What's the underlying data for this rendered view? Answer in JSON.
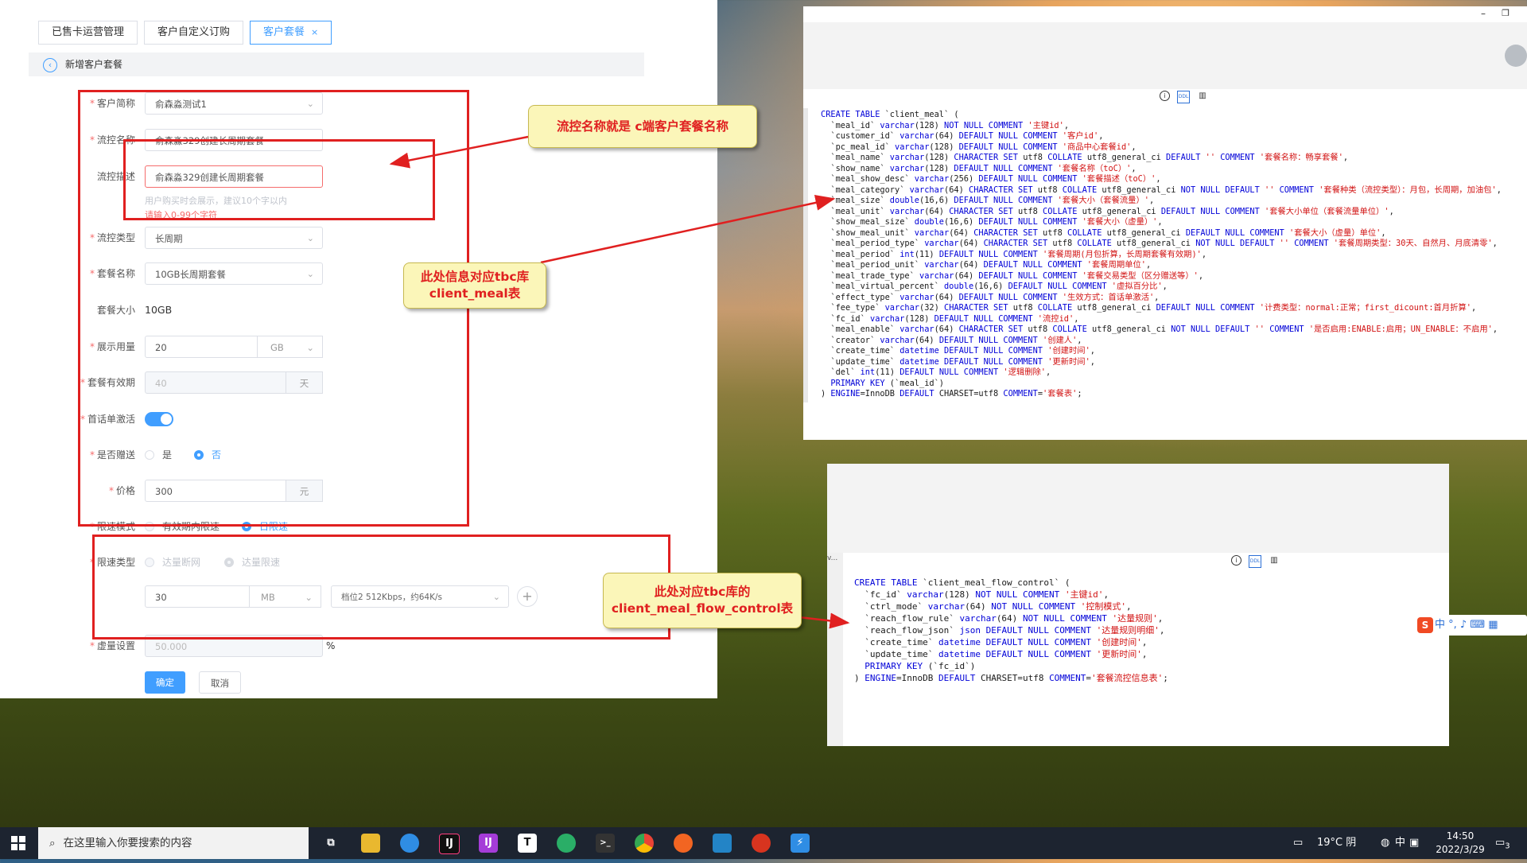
{
  "form": {
    "tabs": [
      {
        "label": "已售卡运营管理"
      },
      {
        "label": "客户自定义订购"
      },
      {
        "label": "客户套餐",
        "close": "×"
      }
    ],
    "section_title": "新增客户套餐",
    "back_glyph": "‹",
    "fields": {
      "customer_label": "客户简称",
      "customer_value": "俞森淼测试1",
      "flow_name_label": "流控名称",
      "flow_name_value": "俞森淼329创建长周期套餐",
      "flow_desc_label": "流控描述",
      "flow_desc_value": "俞森淼329创建长周期套餐",
      "flow_desc_hint": "用户购买时会展示，建议10个字以内",
      "flow_desc_error": "请输入0-99个字符",
      "flow_type_label": "流控类型",
      "flow_type_value": "长周期",
      "meal_name_label": "套餐名称",
      "meal_name_value": "10GB长周期套餐",
      "meal_size_label": "套餐大小",
      "meal_size_value": "10GB",
      "display_usage_label": "展示用量",
      "display_usage_value": "20",
      "display_usage_unit": "GB",
      "validity_label": "套餐有效期",
      "validity_value": "40",
      "validity_unit": "天",
      "first_activate_label": "首话单激活",
      "first_activate_on": true,
      "gift_label": "是否赠送",
      "gift_yes": "是",
      "gift_no": "否",
      "price_label": "价格",
      "price_value": "300",
      "price_unit": "元",
      "limit_mode_label": "限速模式",
      "limit_mode_opt1": "有效期内限速",
      "limit_mode_opt2": "日限速",
      "limit_type_label": "限速类型",
      "limit_type_opt1": "达量断网",
      "limit_type_opt2": "达量限速",
      "limit_amount_value": "30",
      "limit_amount_unit": "MB",
      "limit_speed_value": "档位2  512Kbps，约64K/s",
      "add_glyph": "+",
      "virtual_label": "虚量设置",
      "virtual_placeholder": "50.000",
      "virtual_unit": "%"
    },
    "buttons": {
      "confirm": "确定",
      "cancel": "取消"
    }
  },
  "callouts": {
    "flow_name": "流控名称就是 c端客户套餐名称",
    "client_meal": [
      "此处信息对应tbc库",
      "client_meal表"
    ],
    "flow_control": [
      "此处对应tbc库的",
      "client_meal_flow_control表"
    ]
  },
  "code_top": {
    "lines": [
      [
        [
          "kw",
          "CREATE TABLE "
        ],
        [
          "t",
          "`client_meal` ("
        ]
      ],
      [
        [
          "t",
          "  `meal_id` "
        ],
        [
          "kw",
          "varchar"
        ],
        [
          "t",
          "(128) "
        ],
        [
          "kw",
          "NOT NULL COMMENT "
        ],
        [
          "str",
          "'主键id'"
        ],
        [
          "t",
          ","
        ]
      ],
      [
        [
          "t",
          "  `customer_id` "
        ],
        [
          "kw",
          "varchar"
        ],
        [
          "t",
          "(64) "
        ],
        [
          "kw",
          "DEFAULT NULL COMMENT "
        ],
        [
          "str",
          "'客户id'"
        ],
        [
          "t",
          ","
        ]
      ],
      [
        [
          "t",
          "  `pc_meal_id` "
        ],
        [
          "kw",
          "varchar"
        ],
        [
          "t",
          "(128) "
        ],
        [
          "kw",
          "DEFAULT NULL COMMENT "
        ],
        [
          "str",
          "'商品中心套餐id'"
        ],
        [
          "t",
          ","
        ]
      ],
      [
        [
          "t",
          "  `meal_name` "
        ],
        [
          "kw",
          "varchar"
        ],
        [
          "t",
          "(128) "
        ],
        [
          "kw",
          "CHARACTER SET "
        ],
        [
          "t",
          "utf8 "
        ],
        [
          "kw",
          "COLLATE "
        ],
        [
          "t",
          "utf8_general_ci "
        ],
        [
          "kw",
          "DEFAULT "
        ],
        [
          "str",
          "''"
        ],
        [
          "kw",
          " COMMENT "
        ],
        [
          "str",
          "'套餐名称：畅享套餐'"
        ],
        [
          "t",
          ","
        ]
      ],
      [
        [
          "t",
          "  `show_name` "
        ],
        [
          "kw",
          "varchar"
        ],
        [
          "t",
          "(128) "
        ],
        [
          "kw",
          "DEFAULT NULL COMMENT "
        ],
        [
          "str",
          "'套餐名称（toC）'"
        ],
        [
          "t",
          ","
        ]
      ],
      [
        [
          "t",
          "  `meal_show_desc` "
        ],
        [
          "kw",
          "varchar"
        ],
        [
          "t",
          "(256) "
        ],
        [
          "kw",
          "DEFAULT NULL COMMENT "
        ],
        [
          "str",
          "'套餐描述（toC）'"
        ],
        [
          "t",
          ","
        ]
      ],
      [
        [
          "t",
          "  `meal_category` "
        ],
        [
          "kw",
          "varchar"
        ],
        [
          "t",
          "(64) "
        ],
        [
          "kw",
          "CHARACTER SET "
        ],
        [
          "t",
          "utf8 "
        ],
        [
          "kw",
          "COLLATE "
        ],
        [
          "t",
          "utf8_general_ci "
        ],
        [
          "kw",
          "NOT NULL DEFAULT "
        ],
        [
          "str",
          "''"
        ],
        [
          "kw",
          " COMMENT "
        ],
        [
          "str",
          "'套餐种类（流控类型）：月包，长周期，加油包'"
        ],
        [
          "t",
          ","
        ]
      ],
      [
        [
          "t",
          "  `meal_size` "
        ],
        [
          "kw",
          "double"
        ],
        [
          "t",
          "(16,6) "
        ],
        [
          "kw",
          "DEFAULT NULL COMMENT "
        ],
        [
          "str",
          "'套餐大小（套餐流量）'"
        ],
        [
          "t",
          ","
        ]
      ],
      [
        [
          "t",
          "  `meal_unit` "
        ],
        [
          "kw",
          "varchar"
        ],
        [
          "t",
          "(64) "
        ],
        [
          "kw",
          "CHARACTER SET "
        ],
        [
          "t",
          "utf8 "
        ],
        [
          "kw",
          "COLLATE "
        ],
        [
          "t",
          "utf8_general_ci "
        ],
        [
          "kw",
          "DEFAULT NULL COMMENT "
        ],
        [
          "str",
          "'套餐大小单位（套餐流量单位）'"
        ],
        [
          "t",
          ","
        ]
      ],
      [
        [
          "t",
          "  `show_meal_size` "
        ],
        [
          "kw",
          "double"
        ],
        [
          "t",
          "(16,6) "
        ],
        [
          "kw",
          "DEFAULT NULL COMMENT "
        ],
        [
          "str",
          "'套餐大小（虚量）'"
        ],
        [
          "t",
          ","
        ]
      ],
      [
        [
          "t",
          "  `show_meal_unit` "
        ],
        [
          "kw",
          "varchar"
        ],
        [
          "t",
          "(64) "
        ],
        [
          "kw",
          "CHARACTER SET "
        ],
        [
          "t",
          "utf8 "
        ],
        [
          "kw",
          "COLLATE "
        ],
        [
          "t",
          "utf8_general_ci "
        ],
        [
          "kw",
          "DEFAULT NULL COMMENT "
        ],
        [
          "str",
          "'套餐大小（虚量）单位'"
        ],
        [
          "t",
          ","
        ]
      ],
      [
        [
          "t",
          "  `meal_period_type` "
        ],
        [
          "kw",
          "varchar"
        ],
        [
          "t",
          "(64) "
        ],
        [
          "kw",
          "CHARACTER SET "
        ],
        [
          "t",
          "utf8 "
        ],
        [
          "kw",
          "COLLATE "
        ],
        [
          "t",
          "utf8_general_ci "
        ],
        [
          "kw",
          "NOT NULL DEFAULT "
        ],
        [
          "str",
          "''"
        ],
        [
          "kw",
          " COMMENT "
        ],
        [
          "str",
          "'套餐周期类型：30天、自然月、月底清零'"
        ],
        [
          "t",
          ","
        ]
      ],
      [
        [
          "t",
          "  `meal_period` "
        ],
        [
          "kw",
          "int"
        ],
        [
          "t",
          "(11) "
        ],
        [
          "kw",
          "DEFAULT NULL COMMENT "
        ],
        [
          "str",
          "'套餐周期(月包折算，长周期套餐有效期)'"
        ],
        [
          "t",
          ","
        ]
      ],
      [
        [
          "t",
          "  `meal_period_unit` "
        ],
        [
          "kw",
          "varchar"
        ],
        [
          "t",
          "(64) "
        ],
        [
          "kw",
          "DEFAULT NULL COMMENT "
        ],
        [
          "str",
          "'套餐周期单位'"
        ],
        [
          "t",
          ","
        ]
      ],
      [
        [
          "t",
          "  `meal_trade_type` "
        ],
        [
          "kw",
          "varchar"
        ],
        [
          "t",
          "(64) "
        ],
        [
          "kw",
          "DEFAULT NULL COMMENT "
        ],
        [
          "str",
          "'套餐交易类型（区分赠送等）'"
        ],
        [
          "t",
          ","
        ]
      ],
      [
        [
          "t",
          "  `meal_virtual_percent` "
        ],
        [
          "kw",
          "double"
        ],
        [
          "t",
          "(16,6) "
        ],
        [
          "kw",
          "DEFAULT NULL COMMENT "
        ],
        [
          "str",
          "'虚拟百分比'"
        ],
        [
          "t",
          ","
        ]
      ],
      [
        [
          "t",
          "  `effect_type` "
        ],
        [
          "kw",
          "varchar"
        ],
        [
          "t",
          "(64) "
        ],
        [
          "kw",
          "DEFAULT NULL COMMENT "
        ],
        [
          "str",
          "'生效方式：首话单激活'"
        ],
        [
          "t",
          ","
        ]
      ],
      [
        [
          "t",
          "  `fee_type` "
        ],
        [
          "kw",
          "varchar"
        ],
        [
          "t",
          "(32) "
        ],
        [
          "kw",
          "CHARACTER SET "
        ],
        [
          "t",
          "utf8 "
        ],
        [
          "kw",
          "COLLATE "
        ],
        [
          "t",
          "utf8_general_ci "
        ],
        [
          "kw",
          "DEFAULT NULL COMMENT "
        ],
        [
          "str",
          "'计费类型：normal:正常；first_dicount:首月折算'"
        ],
        [
          "t",
          ","
        ]
      ],
      [
        [
          "t",
          "  `fc_id` "
        ],
        [
          "kw",
          "varchar"
        ],
        [
          "t",
          "(128) "
        ],
        [
          "kw",
          "DEFAULT NULL COMMENT "
        ],
        [
          "str",
          "'流控id'"
        ],
        [
          "t",
          ","
        ]
      ],
      [
        [
          "t",
          "  `meal_enable` "
        ],
        [
          "kw",
          "varchar"
        ],
        [
          "t",
          "(64) "
        ],
        [
          "kw",
          "CHARACTER SET "
        ],
        [
          "t",
          "utf8 "
        ],
        [
          "kw",
          "COLLATE "
        ],
        [
          "t",
          "utf8_general_ci "
        ],
        [
          "kw",
          "NOT NULL DEFAULT "
        ],
        [
          "str",
          "''"
        ],
        [
          "kw",
          " COMMENT "
        ],
        [
          "str",
          "'是否启用:ENABLE:启用；UN_ENABLE：不启用'"
        ],
        [
          "t",
          ","
        ]
      ],
      [
        [
          "t",
          "  `creator` "
        ],
        [
          "kw",
          "varchar"
        ],
        [
          "t",
          "(64) "
        ],
        [
          "kw",
          "DEFAULT NULL COMMENT "
        ],
        [
          "str",
          "'创建人'"
        ],
        [
          "t",
          ","
        ]
      ],
      [
        [
          "t",
          "  `create_time` "
        ],
        [
          "kw",
          "datetime "
        ],
        [
          "kw",
          "DEFAULT NULL COMMENT "
        ],
        [
          "str",
          "'创建时间'"
        ],
        [
          "t",
          ","
        ]
      ],
      [
        [
          "t",
          "  `update_time` "
        ],
        [
          "kw",
          "datetime "
        ],
        [
          "kw",
          "DEFAULT NULL COMMENT "
        ],
        [
          "str",
          "'更新时间'"
        ],
        [
          "t",
          ","
        ]
      ],
      [
        [
          "t",
          "  `del` "
        ],
        [
          "kw",
          "int"
        ],
        [
          "t",
          "(11) "
        ],
        [
          "kw",
          "DEFAULT NULL COMMENT "
        ],
        [
          "str",
          "'逻辑删除'"
        ],
        [
          "t",
          ","
        ]
      ],
      [
        [
          "kw",
          "  PRIMARY KEY "
        ],
        [
          "t",
          "(`meal_id`)"
        ]
      ],
      [
        [
          "t",
          ") "
        ],
        [
          "kw",
          "ENGINE"
        ],
        [
          "t",
          "=InnoDB "
        ],
        [
          "kw",
          "DEFAULT "
        ],
        [
          "t",
          "CHARSET=utf8 "
        ],
        [
          "kw",
          "COMMENT"
        ],
        [
          "t",
          "="
        ],
        [
          "str",
          "'套餐表'"
        ],
        [
          "t",
          ";"
        ]
      ]
    ]
  },
  "code_bottom": {
    "lines": [
      [
        [
          "kw",
          "CREATE TABLE "
        ],
        [
          "t",
          "`client_meal_flow_control` ("
        ]
      ],
      [
        [
          "t",
          "  `fc_id` "
        ],
        [
          "kw",
          "varchar"
        ],
        [
          "t",
          "(128) "
        ],
        [
          "kw",
          "NOT NULL COMMENT "
        ],
        [
          "str",
          "'主键id'"
        ],
        [
          "t",
          ","
        ]
      ],
      [
        [
          "t",
          "  `ctrl_mode` "
        ],
        [
          "kw",
          "varchar"
        ],
        [
          "t",
          "(64) "
        ],
        [
          "kw",
          "NOT NULL COMMENT "
        ],
        [
          "str",
          "'控制模式'"
        ],
        [
          "t",
          ","
        ]
      ],
      [
        [
          "t",
          "  `reach_flow_rule` "
        ],
        [
          "kw",
          "varchar"
        ],
        [
          "t",
          "(64) "
        ],
        [
          "kw",
          "NOT NULL COMMENT "
        ],
        [
          "str",
          "'达量规则'"
        ],
        [
          "t",
          ","
        ]
      ],
      [
        [
          "t",
          "  `reach_flow_json` "
        ],
        [
          "kw",
          "json "
        ],
        [
          "kw",
          "DEFAULT NULL COMMENT "
        ],
        [
          "str",
          "'达量规则明细'"
        ],
        [
          "t",
          ","
        ]
      ],
      [
        [
          "t",
          "  `create_time` "
        ],
        [
          "kw",
          "datetime "
        ],
        [
          "kw",
          "DEFAULT NULL COMMENT "
        ],
        [
          "str",
          "'创建时间'"
        ],
        [
          "t",
          ","
        ]
      ],
      [
        [
          "t",
          "  `update_time` "
        ],
        [
          "kw",
          "datetime "
        ],
        [
          "kw",
          "DEFAULT NULL COMMENT "
        ],
        [
          "str",
          "'更新时间'"
        ],
        [
          "t",
          ","
        ]
      ],
      [
        [
          "kw",
          "  PRIMARY KEY "
        ],
        [
          "t",
          "(`fc_id`)"
        ]
      ],
      [
        [
          "t",
          ") "
        ],
        [
          "kw",
          "ENGINE"
        ],
        [
          "t",
          "=InnoDB "
        ],
        [
          "kw",
          "DEFAULT "
        ],
        [
          "t",
          "CHARSET=utf8 "
        ],
        [
          "kw",
          "COMMENT"
        ],
        [
          "t",
          "="
        ],
        [
          "str",
          "'套餐流控信息表'"
        ],
        [
          "t",
          ";"
        ]
      ]
    ]
  },
  "bottom_side_text": "v...",
  "ime": {
    "mode": "中"
  },
  "taskbar": {
    "search_placeholder": "在这里输入你要搜索的内容",
    "weather": "19°C  阴",
    "ime": "中",
    "time": "14:50",
    "date": "2022/3/29",
    "notif_count": "3"
  },
  "colors": {
    "accent": "#409eff",
    "annotation_red": "#e02020",
    "callout_bg": "#fbf6b9"
  }
}
